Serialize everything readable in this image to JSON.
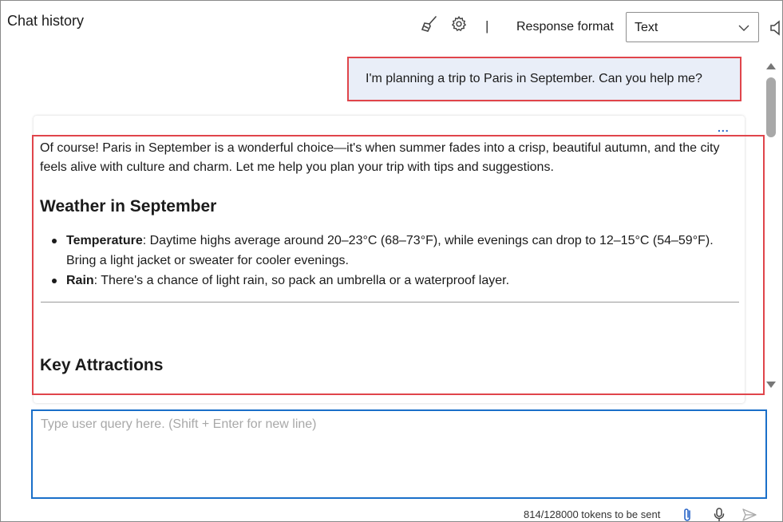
{
  "header": {
    "title": "Chat history",
    "response_format_label": "Response format",
    "response_format_value": "Text",
    "separator": "|",
    "icons": [
      "broom-icon",
      "gear-icon",
      "speaker-icon"
    ]
  },
  "chat": {
    "user_message": "I'm planning a trip to Paris in September. Can you help me?",
    "assistant": {
      "more_label": "...",
      "intro": "Of course! Paris in September is a wonderful choice—it's when summer fades into a crisp, beautiful autumn, and the city feels alive with culture and charm. Let me help you plan your trip with tips and suggestions.",
      "section1_heading": "Weather in September",
      "bullets": [
        {
          "term": "Temperature",
          "text": ": Daytime highs average around 20–23°C (68–73°F), while evenings can drop to 12–15°C (54–59°F). Bring a light jacket or sweater for cooler evenings."
        },
        {
          "term": "Rain",
          "text": ": There's a chance of light rain, so pack an umbrella or a waterproof layer."
        }
      ],
      "section2_heading": "Key Attractions"
    }
  },
  "input": {
    "placeholder": "Type user query here. (Shift + Enter for new line)",
    "value": ""
  },
  "footer": {
    "tokens_text": "814/128000 tokens to be sent",
    "icons": [
      "paperclip-icon",
      "microphone-icon",
      "send-icon"
    ]
  },
  "colors": {
    "highlight": "#e0454b",
    "input_border": "#1a6fc9",
    "user_bubble": "#e9eef8",
    "accent": "#2a66c8"
  }
}
